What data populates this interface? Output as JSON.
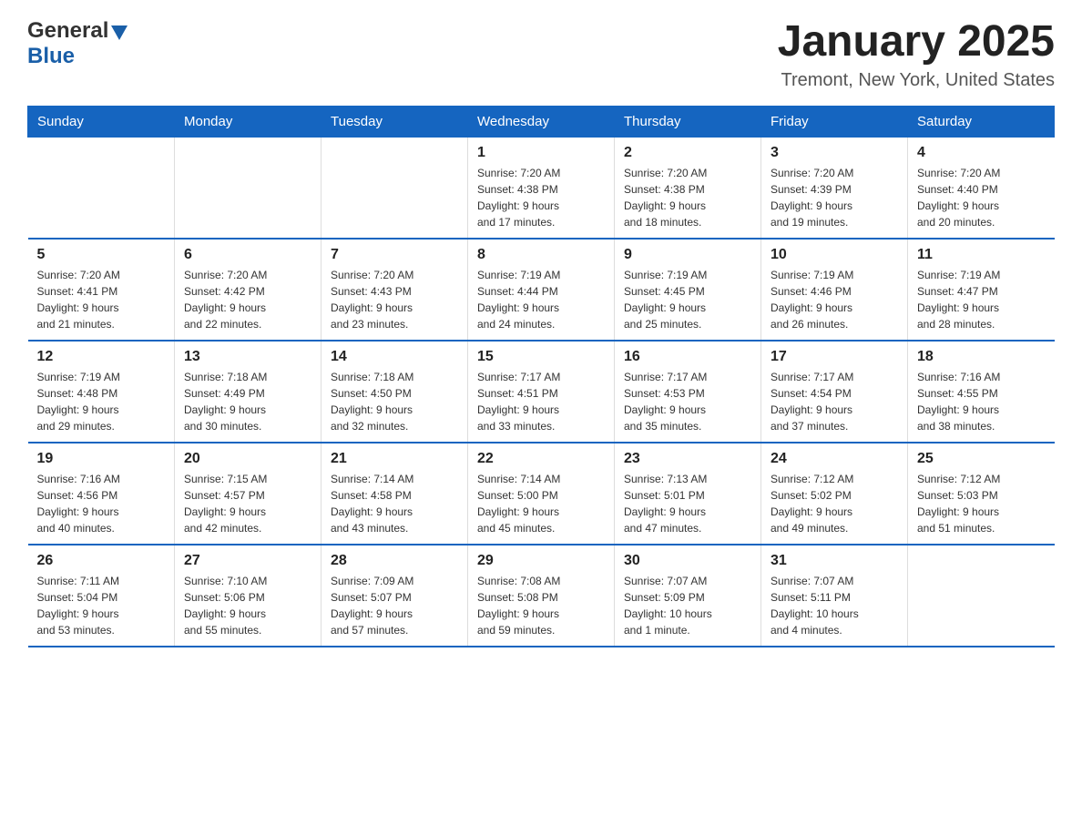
{
  "logo": {
    "general": "General",
    "blue": "Blue"
  },
  "title": "January 2025",
  "subtitle": "Tremont, New York, United States",
  "weekdays": [
    "Sunday",
    "Monday",
    "Tuesday",
    "Wednesday",
    "Thursday",
    "Friday",
    "Saturday"
  ],
  "weeks": [
    [
      {
        "day": "",
        "info": ""
      },
      {
        "day": "",
        "info": ""
      },
      {
        "day": "",
        "info": ""
      },
      {
        "day": "1",
        "info": "Sunrise: 7:20 AM\nSunset: 4:38 PM\nDaylight: 9 hours\nand 17 minutes."
      },
      {
        "day": "2",
        "info": "Sunrise: 7:20 AM\nSunset: 4:38 PM\nDaylight: 9 hours\nand 18 minutes."
      },
      {
        "day": "3",
        "info": "Sunrise: 7:20 AM\nSunset: 4:39 PM\nDaylight: 9 hours\nand 19 minutes."
      },
      {
        "day": "4",
        "info": "Sunrise: 7:20 AM\nSunset: 4:40 PM\nDaylight: 9 hours\nand 20 minutes."
      }
    ],
    [
      {
        "day": "5",
        "info": "Sunrise: 7:20 AM\nSunset: 4:41 PM\nDaylight: 9 hours\nand 21 minutes."
      },
      {
        "day": "6",
        "info": "Sunrise: 7:20 AM\nSunset: 4:42 PM\nDaylight: 9 hours\nand 22 minutes."
      },
      {
        "day": "7",
        "info": "Sunrise: 7:20 AM\nSunset: 4:43 PM\nDaylight: 9 hours\nand 23 minutes."
      },
      {
        "day": "8",
        "info": "Sunrise: 7:19 AM\nSunset: 4:44 PM\nDaylight: 9 hours\nand 24 minutes."
      },
      {
        "day": "9",
        "info": "Sunrise: 7:19 AM\nSunset: 4:45 PM\nDaylight: 9 hours\nand 25 minutes."
      },
      {
        "day": "10",
        "info": "Sunrise: 7:19 AM\nSunset: 4:46 PM\nDaylight: 9 hours\nand 26 minutes."
      },
      {
        "day": "11",
        "info": "Sunrise: 7:19 AM\nSunset: 4:47 PM\nDaylight: 9 hours\nand 28 minutes."
      }
    ],
    [
      {
        "day": "12",
        "info": "Sunrise: 7:19 AM\nSunset: 4:48 PM\nDaylight: 9 hours\nand 29 minutes."
      },
      {
        "day": "13",
        "info": "Sunrise: 7:18 AM\nSunset: 4:49 PM\nDaylight: 9 hours\nand 30 minutes."
      },
      {
        "day": "14",
        "info": "Sunrise: 7:18 AM\nSunset: 4:50 PM\nDaylight: 9 hours\nand 32 minutes."
      },
      {
        "day": "15",
        "info": "Sunrise: 7:17 AM\nSunset: 4:51 PM\nDaylight: 9 hours\nand 33 minutes."
      },
      {
        "day": "16",
        "info": "Sunrise: 7:17 AM\nSunset: 4:53 PM\nDaylight: 9 hours\nand 35 minutes."
      },
      {
        "day": "17",
        "info": "Sunrise: 7:17 AM\nSunset: 4:54 PM\nDaylight: 9 hours\nand 37 minutes."
      },
      {
        "day": "18",
        "info": "Sunrise: 7:16 AM\nSunset: 4:55 PM\nDaylight: 9 hours\nand 38 minutes."
      }
    ],
    [
      {
        "day": "19",
        "info": "Sunrise: 7:16 AM\nSunset: 4:56 PM\nDaylight: 9 hours\nand 40 minutes."
      },
      {
        "day": "20",
        "info": "Sunrise: 7:15 AM\nSunset: 4:57 PM\nDaylight: 9 hours\nand 42 minutes."
      },
      {
        "day": "21",
        "info": "Sunrise: 7:14 AM\nSunset: 4:58 PM\nDaylight: 9 hours\nand 43 minutes."
      },
      {
        "day": "22",
        "info": "Sunrise: 7:14 AM\nSunset: 5:00 PM\nDaylight: 9 hours\nand 45 minutes."
      },
      {
        "day": "23",
        "info": "Sunrise: 7:13 AM\nSunset: 5:01 PM\nDaylight: 9 hours\nand 47 minutes."
      },
      {
        "day": "24",
        "info": "Sunrise: 7:12 AM\nSunset: 5:02 PM\nDaylight: 9 hours\nand 49 minutes."
      },
      {
        "day": "25",
        "info": "Sunrise: 7:12 AM\nSunset: 5:03 PM\nDaylight: 9 hours\nand 51 minutes."
      }
    ],
    [
      {
        "day": "26",
        "info": "Sunrise: 7:11 AM\nSunset: 5:04 PM\nDaylight: 9 hours\nand 53 minutes."
      },
      {
        "day": "27",
        "info": "Sunrise: 7:10 AM\nSunset: 5:06 PM\nDaylight: 9 hours\nand 55 minutes."
      },
      {
        "day": "28",
        "info": "Sunrise: 7:09 AM\nSunset: 5:07 PM\nDaylight: 9 hours\nand 57 minutes."
      },
      {
        "day": "29",
        "info": "Sunrise: 7:08 AM\nSunset: 5:08 PM\nDaylight: 9 hours\nand 59 minutes."
      },
      {
        "day": "30",
        "info": "Sunrise: 7:07 AM\nSunset: 5:09 PM\nDaylight: 10 hours\nand 1 minute."
      },
      {
        "day": "31",
        "info": "Sunrise: 7:07 AM\nSunset: 5:11 PM\nDaylight: 10 hours\nand 4 minutes."
      },
      {
        "day": "",
        "info": ""
      }
    ]
  ]
}
